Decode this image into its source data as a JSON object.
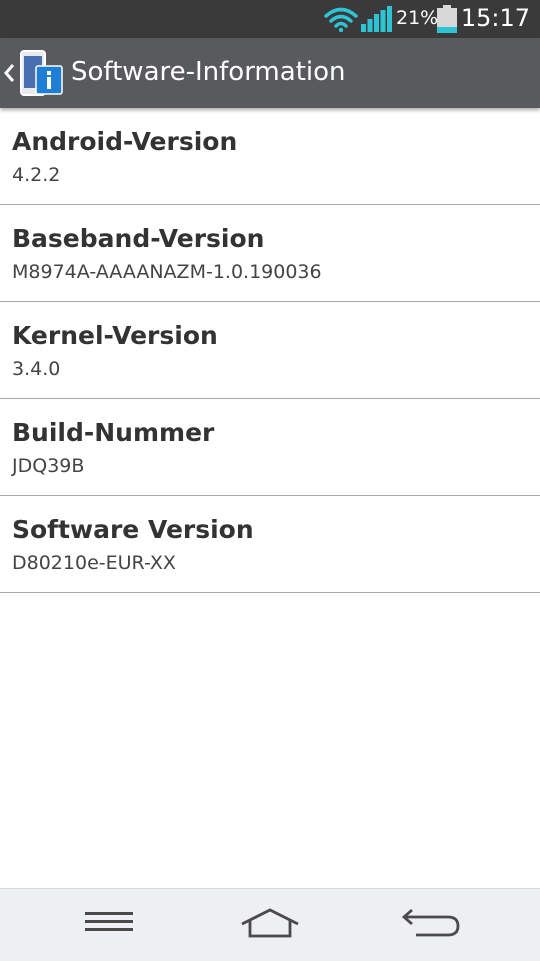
{
  "status_bar": {
    "battery_percent": "21%",
    "time": "15:17",
    "accent_color": "#2ec4d6"
  },
  "header": {
    "title": "Software-Information"
  },
  "items": [
    {
      "title": "Android-Version",
      "value": "4.2.2"
    },
    {
      "title": "Baseband-Version",
      "value": "M8974A-AAAANAZM-1.0.190036"
    },
    {
      "title": "Kernel-Version",
      "value": "3.4.0"
    },
    {
      "title": "Build-Nummer",
      "value": "JDQ39B"
    },
    {
      "title": "Software Version",
      "value": "D80210e-EUR-XX"
    }
  ],
  "nav_bar": {
    "icons": [
      "menu-icon",
      "home-icon",
      "back-icon"
    ]
  }
}
